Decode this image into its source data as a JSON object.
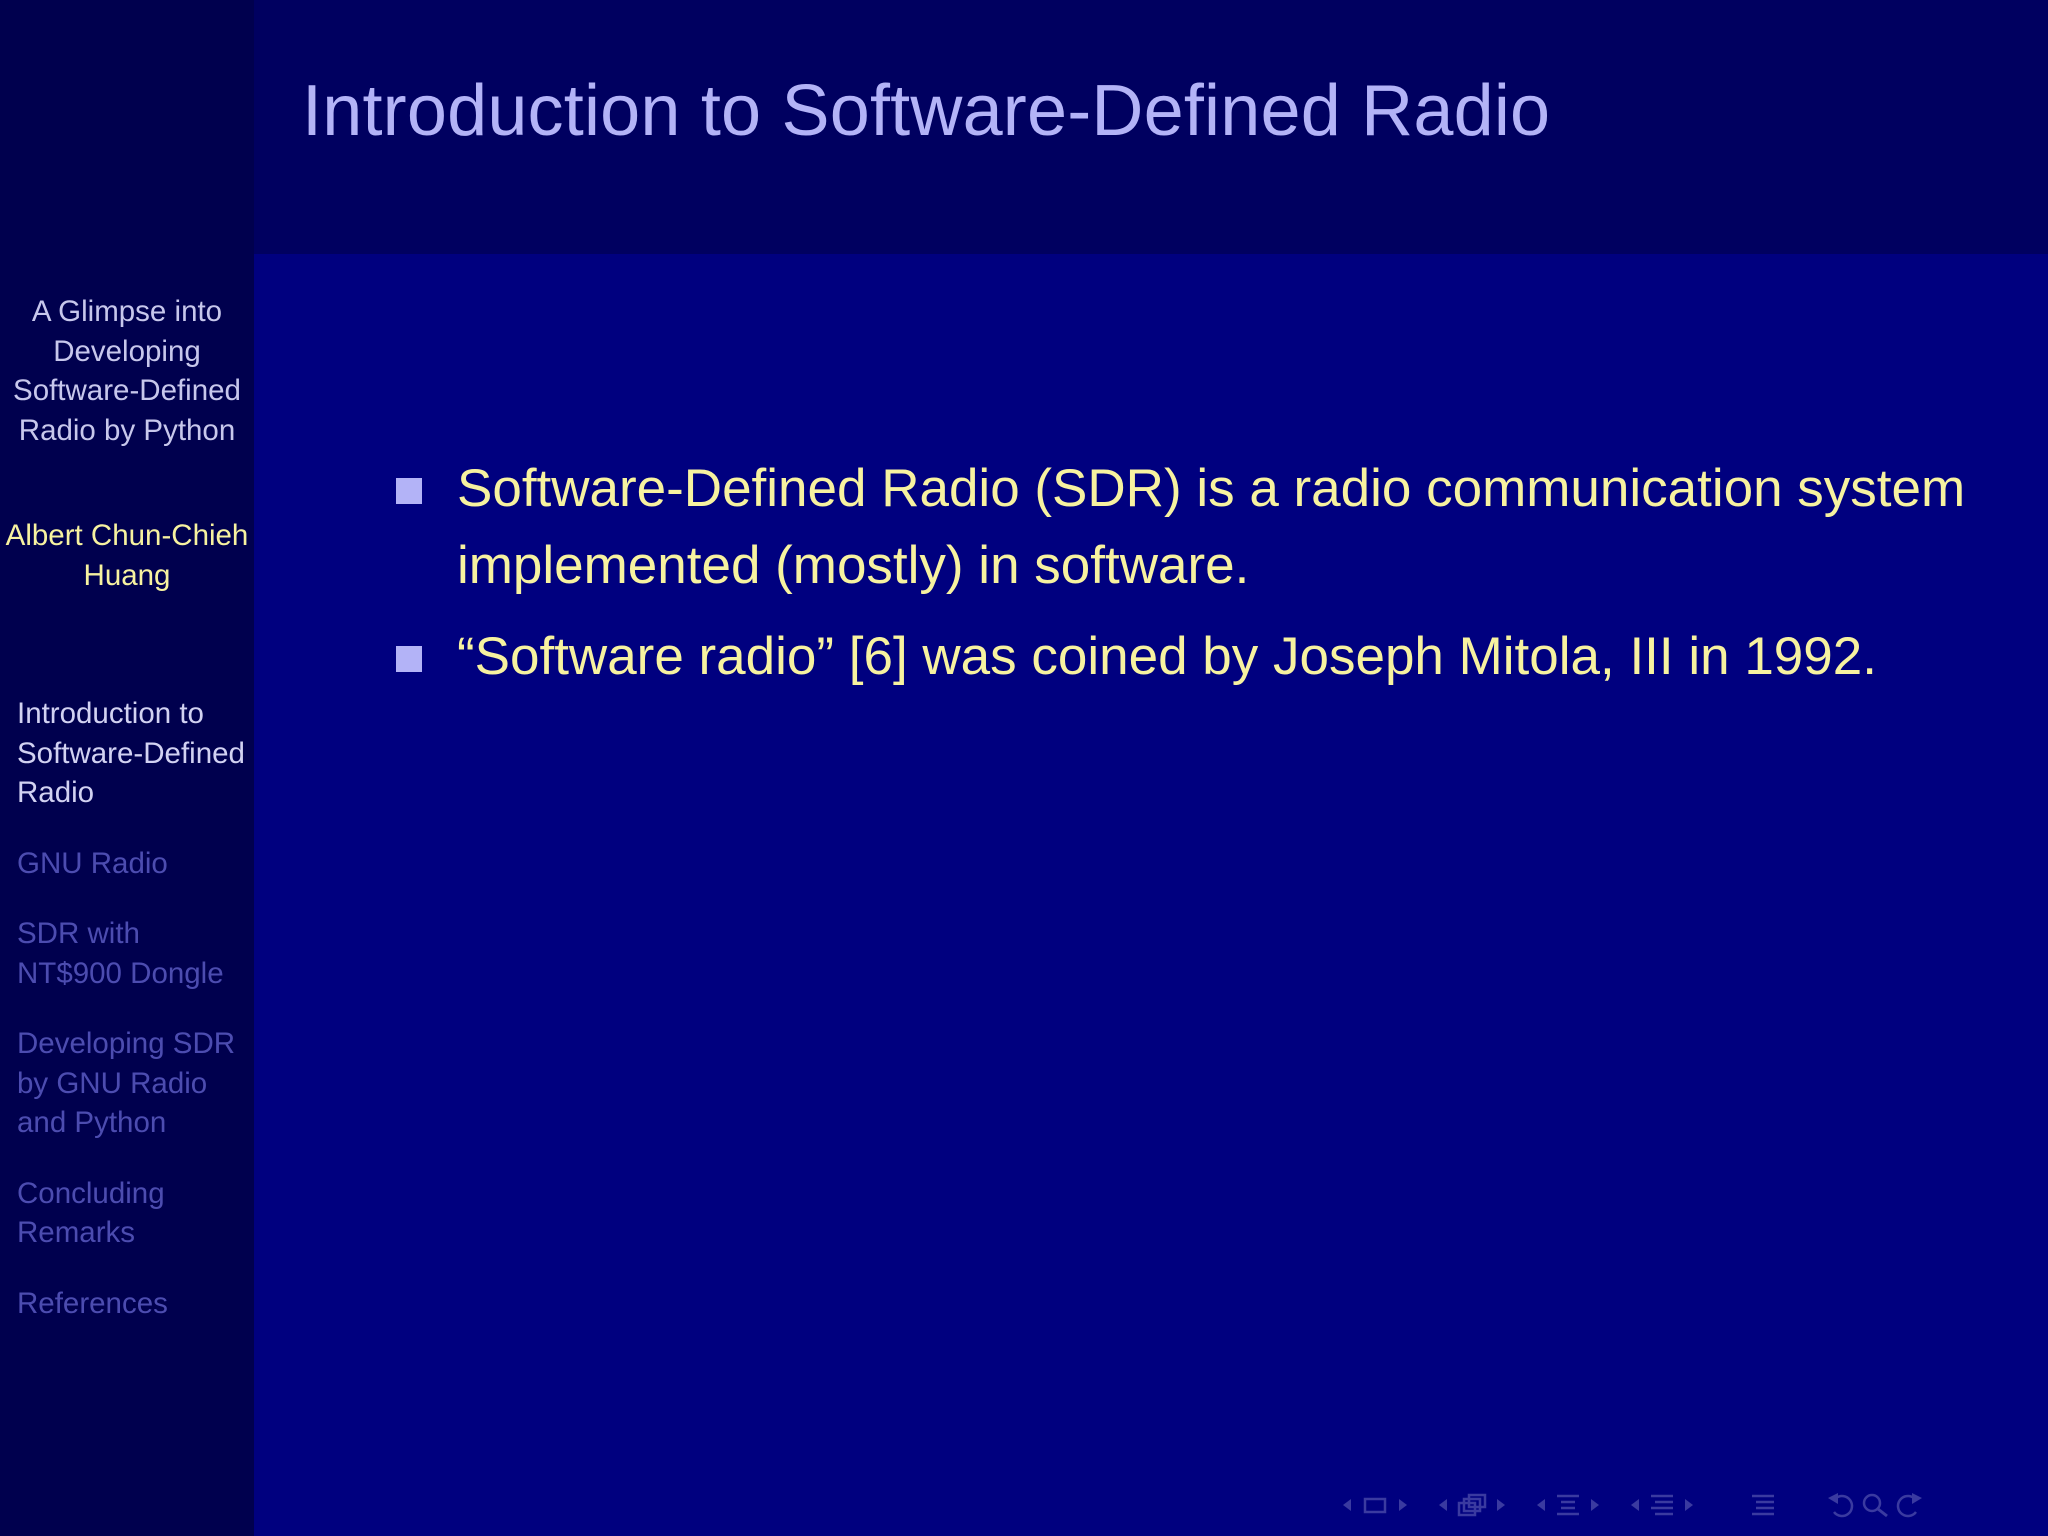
{
  "frame": {
    "title": "Introduction to Software-Defined Radio"
  },
  "sidebar": {
    "talk_title": "A Glimpse into Developing Software-Defined Radio by Python",
    "author": "Albert Chun-Chieh Huang",
    "sections": [
      {
        "label": "Introduction to Software-Defined Radio",
        "current": true
      },
      {
        "label": "GNU Radio",
        "current": false
      },
      {
        "label": "SDR with NT$900 Dongle",
        "current": false
      },
      {
        "label": "Developing SDR by GNU Radio and Python",
        "current": false
      },
      {
        "label": "Concluding Remarks",
        "current": false
      },
      {
        "label": "References",
        "current": false
      }
    ]
  },
  "content": {
    "bullets": [
      "Software-Defined Radio (SDR) is a radio communication system implemented (mostly) in software.",
      "“Software radio” [6] was coined by Joseph Mitola, III in 1992."
    ]
  },
  "navigation": {
    "icons": [
      "prev-slide-arrow-icon",
      "slide-icon",
      "next-slide-arrow-icon",
      "prev-frame-arrow-icon",
      "frame-icon",
      "next-frame-arrow-icon",
      "prev-subsection-arrow-icon",
      "subsection-icon",
      "next-subsection-arrow-icon",
      "prev-section-arrow-icon",
      "section-icon",
      "next-section-arrow-icon",
      "document-icon",
      "back-icon",
      "search-icon",
      "forward-icon"
    ]
  },
  "colors": {
    "background": "#00007f",
    "sidebar": "#00004e",
    "headline": "#000060",
    "title": "#b3b3f7",
    "body_text": "#f7f2a0",
    "toc_active": "#d2d2f2",
    "toc_inactive": "#4c4cb0"
  }
}
